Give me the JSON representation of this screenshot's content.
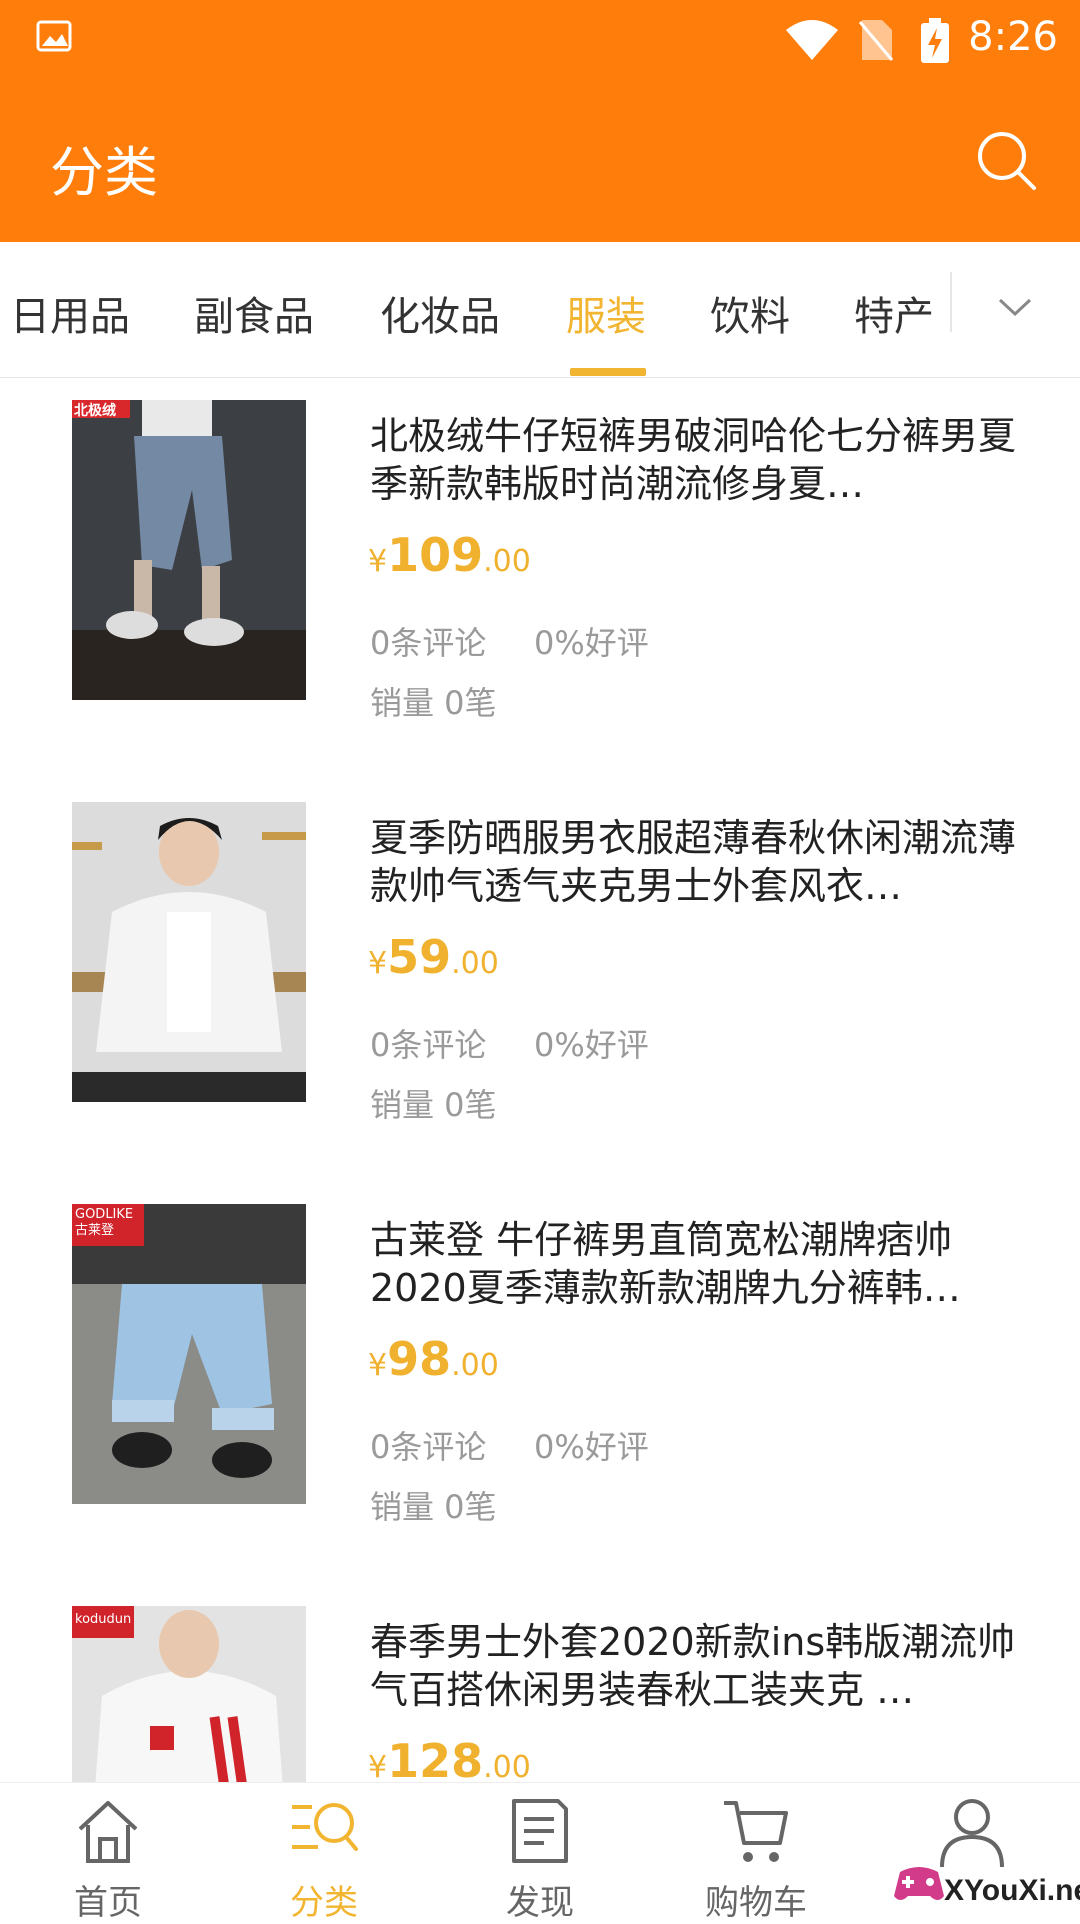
{
  "status_bar": {
    "time": "8:26"
  },
  "header": {
    "title": "分类",
    "search_icon": "search-icon"
  },
  "tabs": [
    {
      "label": "日用品",
      "active": false
    },
    {
      "label": "副食品",
      "active": false
    },
    {
      "label": "化妆品",
      "active": false
    },
    {
      "label": "服装",
      "active": true
    },
    {
      "label": "饮料",
      "active": false
    },
    {
      "label": "特产",
      "active": false
    }
  ],
  "accent_color": "#f2b531",
  "brand_color": "#ff7d0b",
  "products": [
    {
      "title": "北极绒牛仔短裤男破洞哈伦七分裤男夏季新款韩版时尚潮流修身夏…",
      "currency": "¥",
      "price_int": "109",
      "price_dec": ".00",
      "comments": "0条评论",
      "good_rate": "0%好评",
      "sales": "销量 0笔",
      "badge": "北极绒"
    },
    {
      "title": "夏季防晒服男衣服超薄春秋休闲潮流薄款帅气透气夹克男士外套风衣…",
      "currency": "¥",
      "price_int": "59",
      "price_dec": ".00",
      "comments": "0条评论",
      "good_rate": "0%好评",
      "sales": "销量 0笔",
      "badge": ""
    },
    {
      "title": "古莱登 牛仔裤男直筒宽松潮牌痞帅2020夏季薄款新款潮牌九分裤韩…",
      "currency": "¥",
      "price_int": "98",
      "price_dec": ".00",
      "comments": "0条评论",
      "good_rate": "0%好评",
      "sales": "销量 0笔",
      "badge": "GODLIKE 古莱登"
    },
    {
      "title": "春季男士外套2020新款ins韩版潮流帅气百搭休闲男装春秋工装夹克 …",
      "currency": "¥",
      "price_int": "128",
      "price_dec": ".00",
      "comments": "",
      "good_rate": "",
      "sales": "",
      "badge": "kodudun"
    }
  ],
  "bottom_nav": [
    {
      "label": "首页",
      "icon": "home-icon",
      "active": false
    },
    {
      "label": "分类",
      "icon": "category-icon",
      "active": true
    },
    {
      "label": "发现",
      "icon": "discover-icon",
      "active": false
    },
    {
      "label": "购物车",
      "icon": "cart-icon",
      "active": false
    },
    {
      "label": "",
      "icon": "profile-icon",
      "active": false
    }
  ],
  "watermark": "XYouXi.net"
}
